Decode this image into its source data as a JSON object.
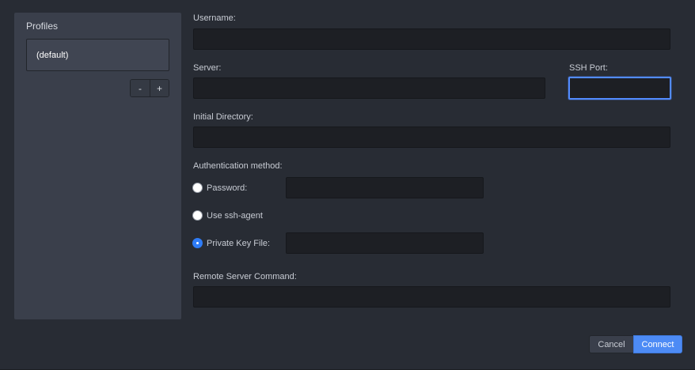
{
  "profiles": {
    "title": "Profiles",
    "items": [
      {
        "label": "(default)"
      }
    ],
    "remove_label": "-",
    "add_label": "+"
  },
  "form": {
    "username": {
      "label": "Username:",
      "value": ""
    },
    "server": {
      "label": "Server:",
      "value": ""
    },
    "ssh_port": {
      "label": "SSH Port:",
      "value": ""
    },
    "initial_directory": {
      "label": "Initial Directory:",
      "value": ""
    },
    "auth": {
      "label": "Authentication method:",
      "options": [
        {
          "label": "Password:",
          "checked": false
        },
        {
          "label": "Use ssh-agent",
          "checked": false
        },
        {
          "label": "Private Key File:",
          "checked": true
        }
      ],
      "password_value": "",
      "key_file_value": ""
    },
    "remote_command": {
      "label": "Remote Server Command:",
      "value": ""
    }
  },
  "footer": {
    "cancel_label": "Cancel",
    "connect_label": "Connect"
  },
  "colors": {
    "accent": "#4d8bf5",
    "focus_ring": "#528bff",
    "background": "#282c34",
    "panel": "#3a3f4b",
    "input_bg": "#1d1f24"
  }
}
